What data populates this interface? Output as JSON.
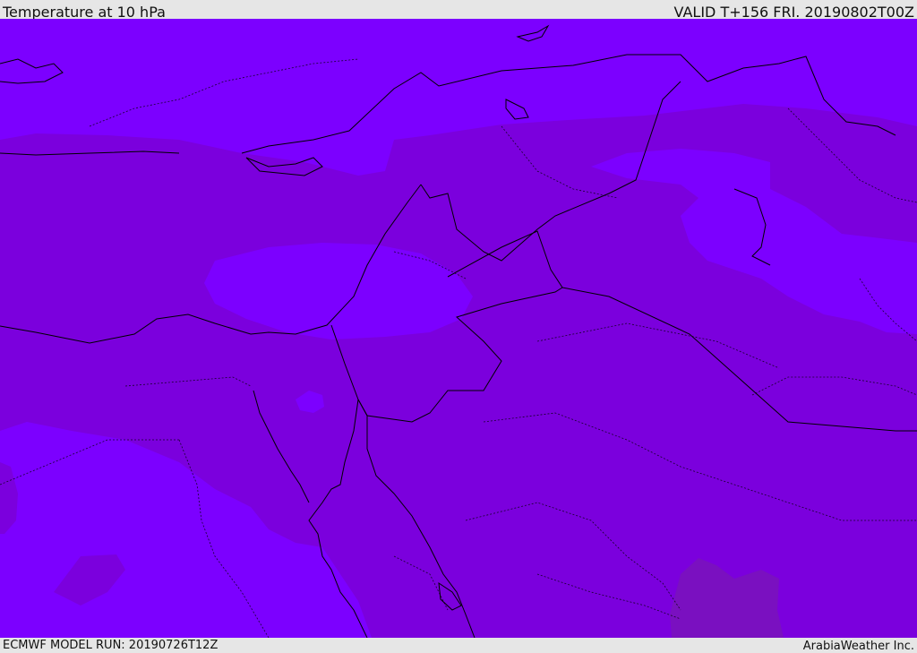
{
  "header": {
    "title": "Temperature at 10 hPa",
    "valid": "VALID T+156 FRI. 20190802T00Z"
  },
  "footer": {
    "model_run": "ECMWF MODEL RUN: 20190726T12Z",
    "credit": "ArabiaWeather Inc."
  },
  "map": {
    "colors": {
      "warm_band": "#7b00dd",
      "cold_band": "#7c00ff",
      "warmest_patch": "#7a10c0",
      "border_line": "#000000"
    }
  }
}
